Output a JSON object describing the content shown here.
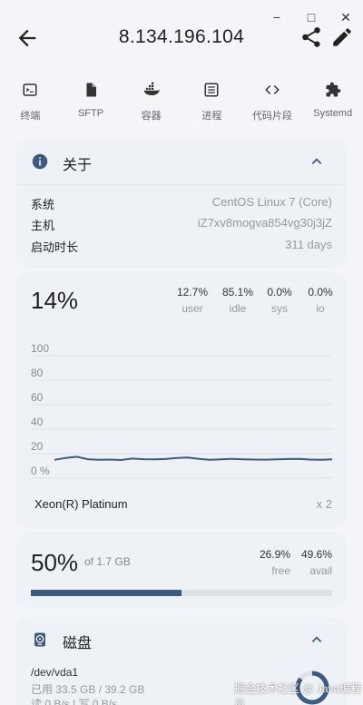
{
  "window_controls": {
    "minimize": "−",
    "maximize": "□",
    "close": "✕"
  },
  "header": {
    "title": "8.134.196.104"
  },
  "toolbar": [
    {
      "icon": "terminal-icon",
      "label": "终端"
    },
    {
      "icon": "file-icon",
      "label": "SFTP"
    },
    {
      "icon": "docker-icon",
      "label": "容器"
    },
    {
      "icon": "list-icon",
      "label": "进程"
    },
    {
      "icon": "code-icon",
      "label": "代码片段"
    },
    {
      "icon": "puzzle-icon",
      "label": "Systemd"
    }
  ],
  "about": {
    "title": "关于",
    "rows": [
      {
        "key": "系统",
        "value": "CentOS Linux 7 (Core)"
      },
      {
        "key": "主机",
        "value": "iZ7xv8mogva854vg30j3jZ"
      },
      {
        "key": "启动时长",
        "value": "311 days"
      }
    ]
  },
  "cpu": {
    "usage": "14%",
    "stats": [
      {
        "value": "12.7%",
        "label": "user"
      },
      {
        "value": "85.1%",
        "label": "idle"
      },
      {
        "value": "0.0%",
        "label": "sys"
      },
      {
        "value": "0.0%",
        "label": "io"
      }
    ],
    "model": "Xeon(R) Platinum",
    "count": "x 2"
  },
  "chart_data": {
    "type": "line",
    "yticks": [
      "100",
      "80",
      "60",
      "40",
      "20",
      "0 %"
    ],
    "ylim": [
      0,
      100
    ],
    "grid": true,
    "series": [
      {
        "values": [
          15,
          16.5,
          17.5,
          15.5,
          15,
          15.2,
          14.8,
          16,
          15.5,
          15.3,
          15.6,
          16.5,
          16.8,
          15.8,
          15,
          15.3,
          15.8,
          15.4,
          15.2,
          15.1,
          15.3,
          15.6,
          15.7,
          15.2,
          15,
          15.4
        ]
      }
    ],
    "color": "#3d5a80"
  },
  "memory": {
    "percent": "50%",
    "of_total": "of 1.7 GB",
    "free_value": "26.9%",
    "free_label": "free",
    "avail_value": "49.6%",
    "avail_label": "avail",
    "used_fraction": 0.5
  },
  "disk": {
    "title": "磁盘",
    "device": "/dev/vda1",
    "used": "已用 33.5 GB / 39.2 GB",
    "io": "读 0 B/s | 写 0 B/s",
    "used_fraction": 0.855
  },
  "watermark": "掘金技术社区 @ Java编程员",
  "colors": {
    "accent": "#3d5a80",
    "card_bg": "#eef1f6",
    "page_bg": "#f3f5f9"
  }
}
